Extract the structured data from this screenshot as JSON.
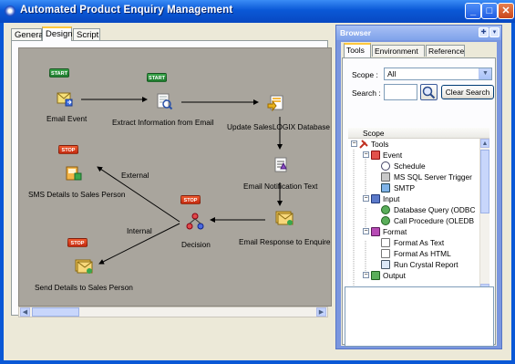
{
  "window": {
    "title": "Automated Product Enquiry Management",
    "controls": [
      "minimize",
      "maximize",
      "close"
    ]
  },
  "tabs": [
    {
      "label": "General",
      "active": false
    },
    {
      "label": "Design",
      "active": true
    },
    {
      "label": "Script",
      "active": false
    }
  ],
  "diagram": {
    "nodes": {
      "email_event": {
        "label": "Email Event",
        "badge": "START"
      },
      "extract_info": {
        "label": "Extract Information from Email",
        "badge": "START"
      },
      "update_db": {
        "label": "Update SalesLOGIX Database"
      },
      "email_notification": {
        "label": "Email Notification Text"
      },
      "email_response": {
        "label": "Email Response to Enquirer"
      },
      "decision": {
        "label": "Decision",
        "badge": "STOP"
      },
      "sms_details": {
        "label": "SMS Details to Sales Person",
        "badge": "STOP"
      },
      "send_details": {
        "label": "Send Details to Sales Person",
        "badge": "STOP"
      }
    },
    "edges": {
      "external": "External",
      "internal": "Internal"
    }
  },
  "browser": {
    "title": "Browser",
    "tabs": [
      {
        "label": "Tools",
        "active": true
      },
      {
        "label": "Environment",
        "active": false
      },
      {
        "label": "Reference",
        "active": false
      }
    ],
    "scope_label": "Scope :",
    "scope_value": "All",
    "search_label": "Search :",
    "search_value": "",
    "clear_search": "Clear Search",
    "tree_header": "Scope",
    "tree": {
      "root": "Tools",
      "event": "Event",
      "schedule": "Schedule",
      "ms_sql": "MS SQL Server Trigger",
      "smtp": "SMTP",
      "input": "Input",
      "db_query": "Database Query (ODBC",
      "call_proc": "Call Procedure (OLEDB",
      "format": "Format",
      "format_text": "Format As Text",
      "format_html": "Format As HTML",
      "run_crystal": "Run Crystal Report",
      "output": "Output"
    }
  },
  "colors": {
    "titlebar": "#0a58d6",
    "canvas": "#a9a59d",
    "start_badge": "#2a8f3a",
    "stop_badge": "#e0431c",
    "browser_frame": "#7a96df"
  }
}
